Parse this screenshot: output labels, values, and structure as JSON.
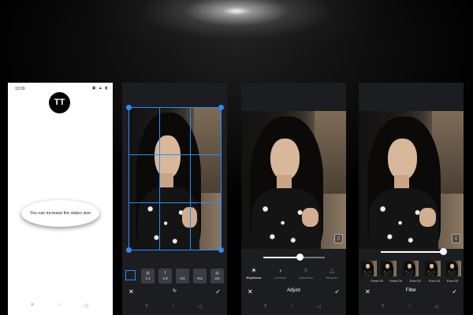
{
  "screen1": {
    "time": "13:09",
    "status_icons": "▣ ▲ ▮",
    "logo_text": "TT",
    "bubble_text_main": "You can increase the ",
    "bubble_text_italic": "status",
    "bubble_text_end": " size",
    "nav": [
      "≡",
      "○",
      "◁"
    ]
  },
  "screen2": {
    "ratios": [
      {
        "icon": "◎",
        "label": "1:1"
      },
      {
        "icon": "f",
        "label": "4:3"
      },
      {
        "icon": "",
        "label": "3:4"
      },
      {
        "icon": "",
        "label": "9:4"
      },
      {
        "icon": "◎",
        "label": "4:5"
      }
    ],
    "cancel": "✕",
    "rotate": "↻",
    "confirm": "✓",
    "nav": [
      "≡",
      "○",
      "◁"
    ]
  },
  "screen3": {
    "title": "Adjust",
    "slider_value": 0.6,
    "tools": [
      {
        "icon": "☀",
        "label": "Brightness",
        "active": true
      },
      {
        "icon": "◑",
        "label": "Contrast",
        "active": false
      },
      {
        "icon": "◊",
        "label": "Saturation",
        "active": false
      },
      {
        "icon": "△",
        "label": "Sharpen",
        "active": false
      }
    ],
    "cancel": "✕",
    "confirm": "✓",
    "compare": "▯",
    "nav": [
      "≡",
      "○",
      "◁"
    ]
  },
  "screen4": {
    "title": "Filter",
    "slider_value": 1.0,
    "filters": [
      "Fresh 03",
      "Fresh 04",
      "Euro 01",
      "Euro 02",
      "Euro 03"
    ],
    "cancel": "✕",
    "confirm": "✓",
    "compare": "▯",
    "nav": [
      "≡",
      "○",
      "◁"
    ]
  },
  "colors": {
    "accent_blue": "#2f8bf5",
    "dark_panel": "#1c1d21"
  }
}
